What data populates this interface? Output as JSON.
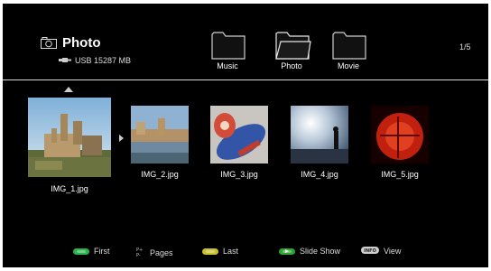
{
  "header": {
    "title": "Photo",
    "camera_icon": "camera-icon",
    "device_icon": "usb-icon",
    "device_label": "USB 15287 MB",
    "page_indicator": "1/5"
  },
  "folders": [
    {
      "label": "Music",
      "icon": "folder-icon",
      "open": false
    },
    {
      "label": "Photo",
      "icon": "folder-open-icon",
      "open": true
    },
    {
      "label": "Movie",
      "icon": "folder-icon",
      "open": false
    }
  ],
  "thumbnails": [
    {
      "name": "IMG_1.jpg",
      "selected": true
    },
    {
      "name": "IMG_2.jpg",
      "selected": false
    },
    {
      "name": "IMG_3.jpg",
      "selected": false
    },
    {
      "name": "IMG_4.jpg",
      "selected": false
    },
    {
      "name": "IMG_5.jpg",
      "selected": false
    }
  ],
  "footer": {
    "first": {
      "label": "First",
      "color": "#2bb24c"
    },
    "pages": {
      "label": "Pages",
      "icon": "page-updown-icon"
    },
    "last": {
      "label": "Last",
      "color": "#c8c030"
    },
    "slideshow": {
      "label": "Slide Show",
      "color": "#2ca531",
      "icon": "play-icon"
    },
    "view": {
      "label": "View",
      "icon": "info-icon"
    }
  }
}
